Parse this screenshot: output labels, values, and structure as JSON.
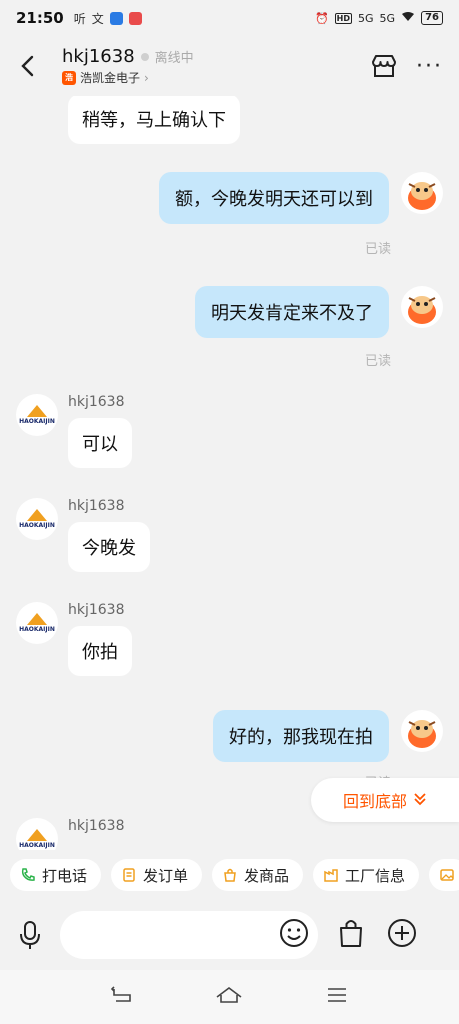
{
  "status_bar": {
    "time": "21:50",
    "left_icons": [
      "听",
      "文"
    ],
    "signal1": "5G",
    "signal2": "5G",
    "hd": "HD",
    "battery": "76"
  },
  "header": {
    "title": "hkj1638",
    "status": "离线中",
    "shop_badge": "浩",
    "shop_name": "浩凯金电子",
    "shop_chevron": "›"
  },
  "messages": {
    "m0": {
      "text": "稍等，马上确认下"
    },
    "m1": {
      "text": "额，今晚发明天还可以到",
      "read": "已读"
    },
    "m2": {
      "text": "明天发肯定来不及了",
      "read": "已读"
    },
    "m3": {
      "sender": "hkj1638",
      "text": "可以"
    },
    "m4": {
      "sender": "hkj1638",
      "text": "今晚发"
    },
    "m5": {
      "sender": "hkj1638",
      "text": "你拍"
    },
    "m6": {
      "text": "好的，那我现在拍",
      "read": "已读"
    },
    "m7": {
      "sender": "hkj1638"
    }
  },
  "avatar_brand": "HAOKAIJIN",
  "back_to_bottom": {
    "label": "回到底部"
  },
  "quick_actions": [
    {
      "label": "打电话",
      "icon": "phone-icon"
    },
    {
      "label": "发订单",
      "icon": "order-icon"
    },
    {
      "label": "发商品",
      "icon": "bag-icon"
    },
    {
      "label": "工厂信息",
      "icon": "factory-icon"
    }
  ],
  "input": {
    "placeholder": "",
    "value": ""
  },
  "colors": {
    "accent": "#ff5500",
    "bubble_out": "#c6e7fb",
    "background": "#f2f2f2"
  }
}
